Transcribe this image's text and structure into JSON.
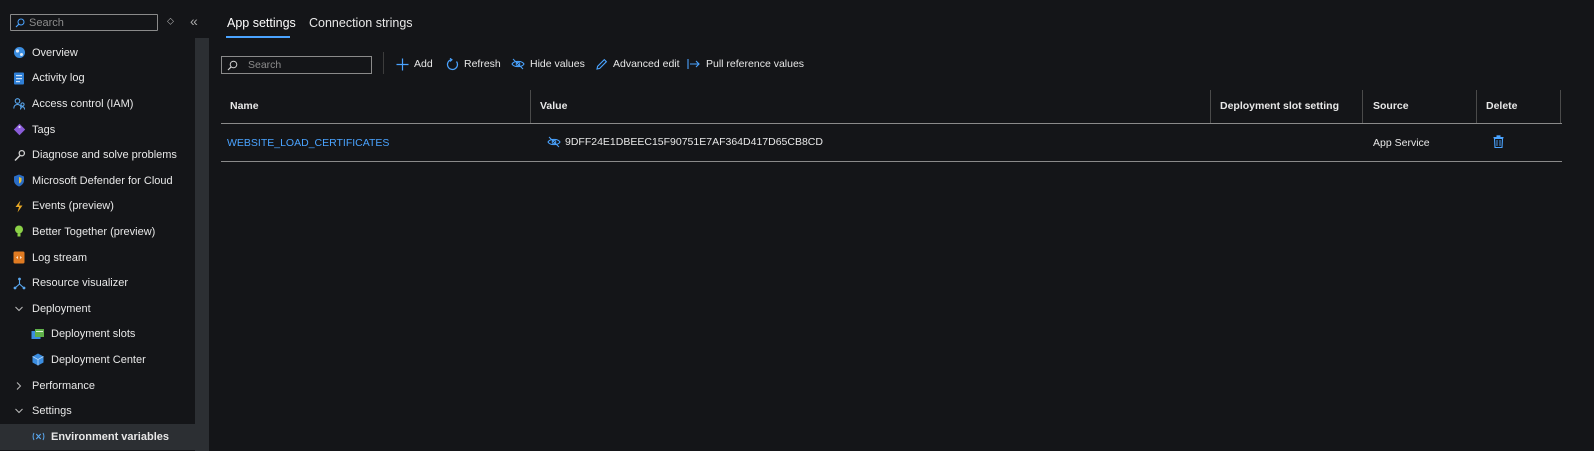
{
  "sidebar": {
    "search_placeholder": "Search",
    "items": [
      {
        "label": "Overview",
        "icon": "globe-icon"
      },
      {
        "label": "Activity log",
        "icon": "activity-log-icon"
      },
      {
        "label": "Access control (IAM)",
        "icon": "people-icon"
      },
      {
        "label": "Tags",
        "icon": "tag-icon"
      },
      {
        "label": "Diagnose and solve problems",
        "icon": "wrench-icon"
      },
      {
        "label": "Microsoft Defender for Cloud",
        "icon": "shield-icon"
      },
      {
        "label": "Events (preview)",
        "icon": "lightning-icon"
      },
      {
        "label": "Better Together (preview)",
        "icon": "lightbulb-icon"
      },
      {
        "label": "Log stream",
        "icon": "log-stream-icon"
      },
      {
        "label": "Resource visualizer",
        "icon": "hierarchy-icon"
      },
      {
        "label": "Deployment",
        "icon": "chevron-down-icon"
      },
      {
        "label": "Deployment slots",
        "icon": "slots-icon"
      },
      {
        "label": "Deployment Center",
        "icon": "cube-icon"
      },
      {
        "label": "Performance",
        "icon": "chevron-right-icon"
      },
      {
        "label": "Settings",
        "icon": "chevron-down-icon"
      },
      {
        "label": "Environment variables",
        "icon": "variable-icon"
      }
    ]
  },
  "tabs": {
    "app_settings": "App settings",
    "connection_strings": "Connection strings"
  },
  "toolbar": {
    "search_placeholder": "Search",
    "add": "Add",
    "refresh": "Refresh",
    "hide_values": "Hide values",
    "advanced_edit": "Advanced edit",
    "pull_reference_values": "Pull reference values"
  },
  "grid": {
    "columns": [
      "Name",
      "Value",
      "Deployment slot setting",
      "Source",
      "Delete"
    ],
    "rows": [
      {
        "name": "WEBSITE_LOAD_CERTIFICATES",
        "value": "9DFF24E1DBEEC15F90751E7AF364D417D65CB8CD",
        "slot_setting": "",
        "source": "App Service"
      }
    ]
  },
  "colors": {
    "background": "#141518",
    "accent": "#4aa3ff",
    "selected": "#2c2f33"
  }
}
